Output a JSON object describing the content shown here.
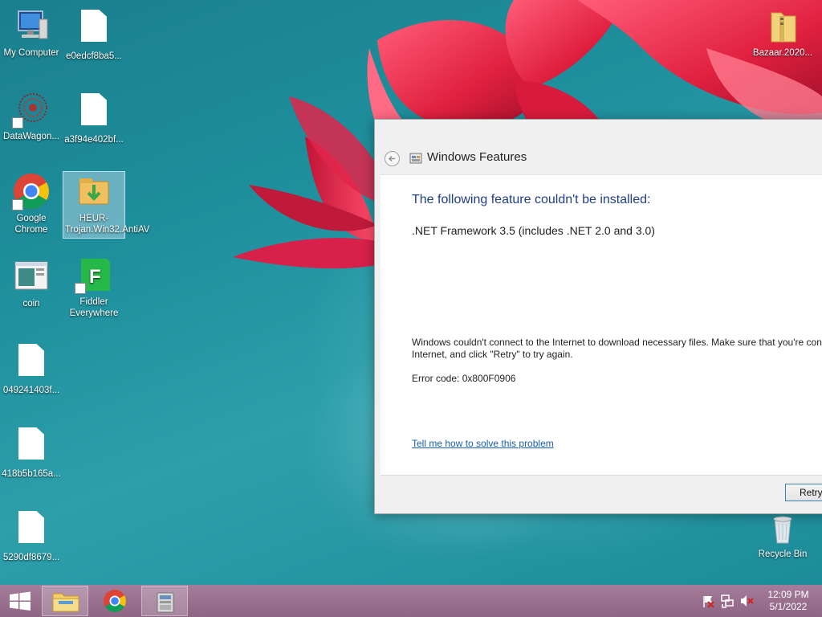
{
  "desktop": {
    "icons": [
      {
        "label": "My Computer"
      },
      {
        "label": "e0edcf8ba5..."
      },
      {
        "label": "DataWagon..."
      },
      {
        "label": "a3f94e402bf..."
      },
      {
        "label": "Google Chrome"
      },
      {
        "label": "HEUR-Trojan.Win32.AntiAV"
      },
      {
        "label": "coin"
      },
      {
        "label": "Fiddler Everywhere"
      },
      {
        "label": "049241403f..."
      },
      {
        "label": "418b5b165a..."
      },
      {
        "label": "5290df8679..."
      },
      {
        "label": "Bazaar.2020..."
      },
      {
        "label": "Recycle Bin"
      }
    ]
  },
  "dialog": {
    "title": "Windows Features",
    "heading": "The following feature couldn't be installed:",
    "feature": ".NET Framework 3.5 (includes .NET 2.0 and 3.0)",
    "message_line1": "Windows couldn't connect to the Internet to download necessary files. Make sure that you're con",
    "message_line2": "Internet, and click \"Retry\" to try again.",
    "error_code": "Error code: 0x800F0906",
    "help_link": "Tell me how to solve this problem",
    "retry_label": "Retry"
  },
  "taskbar": {
    "pinned": [
      "file-explorer-icon",
      "chrome-icon",
      "installer-icon"
    ],
    "tray_icons": [
      "action-center-flag-icon",
      "network-icon",
      "volume-muted-icon"
    ],
    "time": "12:09 PM",
    "date": "5/1/2022"
  },
  "colors": {
    "heading": "#1f3d8c",
    "link": "#1a5fb4",
    "taskbar": "#9a708f",
    "wallpaper": "#1d8a99"
  }
}
